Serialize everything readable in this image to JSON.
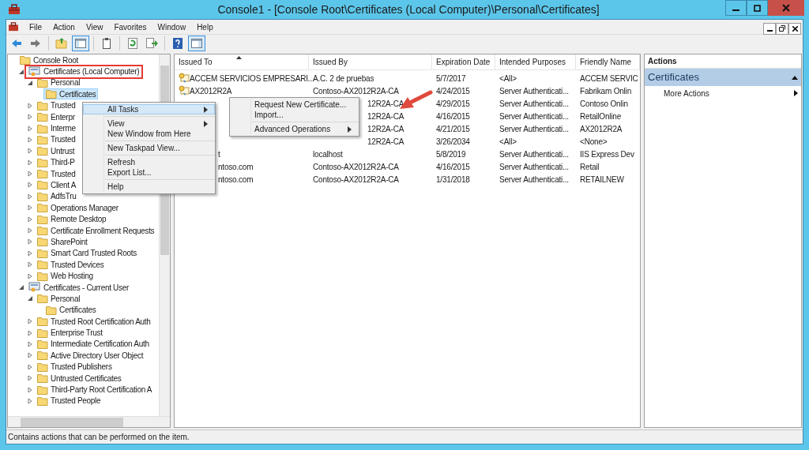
{
  "window": {
    "title": "Console1 - [Console Root\\Certificates (Local Computer)\\Personal\\Certificates]"
  },
  "menu_bar": [
    "File",
    "Action",
    "View",
    "Favorites",
    "Window",
    "Help"
  ],
  "toolbar": [
    {
      "kind": "back",
      "pressed": false
    },
    {
      "kind": "forward",
      "pressed": false
    },
    {
      "kind": "separator"
    },
    {
      "kind": "up",
      "pressed": false
    },
    {
      "kind": "tree",
      "pressed": true
    },
    {
      "kind": "separator"
    },
    {
      "kind": "clipboard",
      "pressed": false
    },
    {
      "kind": "separator"
    },
    {
      "kind": "refresh",
      "pressed": false
    },
    {
      "kind": "export",
      "pressed": false
    },
    {
      "kind": "separator"
    },
    {
      "kind": "help",
      "pressed": false
    },
    {
      "kind": "pane",
      "pressed": true
    }
  ],
  "tree": [
    {
      "label": "Console Root",
      "kind": "folder",
      "selected": false,
      "highlighted": false,
      "children": [
        {
          "label": "Certificates (Local Computer)",
          "kind": "snapin",
          "expanded": true,
          "selected": false,
          "highlighted": true,
          "children": [
            {
              "label": "Personal",
              "kind": "folder",
              "expanded": true,
              "selected": false,
              "highlighted": false,
              "children": [
                {
                  "label": "Certificates",
                  "kind": "folder",
                  "selected": true,
                  "highlighted": false
                }
              ]
            },
            {
              "label": "Trusted",
              "kind": "folder",
              "expanded": false,
              "selected": false,
              "highlighted": false
            },
            {
              "label": "Enterpr",
              "kind": "folder",
              "expanded": false,
              "selected": false,
              "highlighted": false
            },
            {
              "label": "Interme",
              "kind": "folder",
              "expanded": false,
              "selected": false,
              "highlighted": false
            },
            {
              "label": "Trusted",
              "kind": "folder",
              "expanded": false,
              "selected": false,
              "highlighted": false
            },
            {
              "label": "Untrust",
              "kind": "folder",
              "expanded": false,
              "selected": false,
              "highlighted": false
            },
            {
              "label": "Third-P",
              "kind": "folder",
              "expanded": false,
              "selected": false,
              "highlighted": false
            },
            {
              "label": "Trusted",
              "kind": "folder",
              "expanded": false,
              "selected": false,
              "highlighted": false
            },
            {
              "label": "Client A",
              "kind": "folder",
              "expanded": false,
              "selected": false,
              "highlighted": false
            },
            {
              "label": "AdfsTru",
              "kind": "folder",
              "expanded": false,
              "selected": false,
              "highlighted": false
            },
            {
              "label": "Operations Manager",
              "kind": "folder",
              "expanded": false,
              "selected": false,
              "highlighted": false
            },
            {
              "label": "Remote Desktop",
              "kind": "folder",
              "expanded": false,
              "selected": false,
              "highlighted": false
            },
            {
              "label": "Certificate Enrollment Requests",
              "kind": "folder",
              "expanded": false,
              "selected": false,
              "highlighted": false
            },
            {
              "label": "SharePoint",
              "kind": "folder",
              "expanded": false,
              "selected": false,
              "highlighted": false
            },
            {
              "label": "Smart Card Trusted Roots",
              "kind": "folder",
              "expanded": false,
              "selected": false,
              "highlighted": false
            },
            {
              "label": "Trusted Devices",
              "kind": "folder",
              "expanded": false,
              "selected": false,
              "highlighted": false
            },
            {
              "label": "Web Hosting",
              "kind": "folder",
              "expanded": false,
              "selected": false,
              "highlighted": false
            }
          ]
        },
        {
          "label": "Certificates - Current User",
          "kind": "snapin",
          "expanded": true,
          "selected": false,
          "highlighted": false,
          "children": [
            {
              "label": "Personal",
              "kind": "folder",
              "expanded": true,
              "selected": false,
              "highlighted": false,
              "children": [
                {
                  "label": "Certificates",
                  "kind": "folder",
                  "selected": false,
                  "highlighted": false
                }
              ]
            },
            {
              "label": "Trusted Root Certification Auth",
              "kind": "folder",
              "expanded": false,
              "selected": false,
              "highlighted": false
            },
            {
              "label": "Enterprise Trust",
              "kind": "folder",
              "expanded": false,
              "selected": false,
              "highlighted": false
            },
            {
              "label": "Intermediate Certification Auth",
              "kind": "folder",
              "expanded": false,
              "selected": false,
              "highlighted": false
            },
            {
              "label": "Active Directory User Object",
              "kind": "folder",
              "expanded": false,
              "selected": false,
              "highlighted": false
            },
            {
              "label": "Trusted Publishers",
              "kind": "folder",
              "expanded": false,
              "selected": false,
              "highlighted": false
            },
            {
              "label": "Untrusted Certificates",
              "kind": "folder",
              "expanded": false,
              "selected": false,
              "highlighted": false
            },
            {
              "label": "Third-Party Root Certification A",
              "kind": "folder",
              "expanded": false,
              "selected": false,
              "highlighted": false
            },
            {
              "label": "Trusted People",
              "kind": "folder",
              "expanded": false,
              "selected": false,
              "highlighted": false
            }
          ]
        }
      ]
    }
  ],
  "table": {
    "columns": [
      "Issued To",
      "Issued By",
      "Expiration Date",
      "Intended Purposes",
      "Friendly Name"
    ],
    "rows": [
      {
        "issued_to": "ACCEM SERVICIOS EMPRESARI...",
        "issued_to_covered": false,
        "issued_by": "A.C. 2 de pruebas",
        "issued_by_covered": false,
        "expiration_date": "5/7/2017",
        "intended_purposes": "<All>",
        "friendly_name": "ACCEM SERVIC"
      },
      {
        "issued_to": "AX2012R2A",
        "issued_to_covered": false,
        "issued_by": "Contoso-AX2012R2A-CA",
        "issued_by_covered": false,
        "expiration_date": "4/24/2015",
        "intended_purposes": "Server Authenticati...",
        "friendly_name": "Fabrikam Onlin"
      },
      {
        "issued_to_covered": true,
        "issued_by": "12R2A-CA",
        "issued_by_covered": true,
        "expiration_date": "4/29/2015",
        "intended_purposes": "Server Authenticati...",
        "friendly_name": "Contoso Onlin"
      },
      {
        "issued_to_covered": true,
        "issued_by": "12R2A-CA",
        "issued_by_covered": true,
        "expiration_date": "4/16/2015",
        "intended_purposes": "Server Authenticati...",
        "friendly_name": "RetailOnline"
      },
      {
        "issued_to_covered": true,
        "issued_by": "12R2A-CA",
        "issued_by_covered": true,
        "expiration_date": "4/21/2015",
        "intended_purposes": "Server Authenticati...",
        "friendly_name": "AX2012R2A"
      },
      {
        "issued_to_covered": true,
        "issued_by": "12R2A-CA",
        "issued_by_covered": true,
        "expiration_date": "3/26/2034",
        "intended_purposes": "<All>",
        "friendly_name": "<None>"
      },
      {
        "issued_to": "t",
        "issued_to_covered": true,
        "issued_by": "localhost",
        "issued_by_covered": false,
        "expiration_date": "5/8/2019",
        "intended_purposes": "Server Authenticati...",
        "friendly_name": "IIS Express Dev"
      },
      {
        "issued_to": "ntoso.com",
        "issued_to_covered": true,
        "issued_by": "Contoso-AX2012R2A-CA",
        "issued_by_covered": false,
        "expiration_date": "4/16/2015",
        "intended_purposes": "Server Authenticati...",
        "friendly_name": "Retail"
      },
      {
        "issued_to": "ntoso.com",
        "issued_to_covered": true,
        "issued_by": "Contoso-AX2012R2A-CA",
        "issued_by_covered": false,
        "expiration_date": "1/31/2018",
        "intended_purposes": "Server Authenticati...",
        "friendly_name": "RETAILNEW"
      }
    ]
  },
  "actions": {
    "title": "Actions",
    "section": {
      "title": "Certificates",
      "expanded": true
    },
    "items": [
      {
        "label": "More Actions",
        "submenu": true
      }
    ]
  },
  "context_menu": {
    "groups": [
      [
        {
          "label": "All Tasks",
          "submenu": true,
          "selected": true
        }
      ],
      [
        {
          "label": "View",
          "submenu": true,
          "selected": false
        },
        {
          "label": "New Window from Here",
          "submenu": false,
          "selected": false
        }
      ],
      [
        {
          "label": "New Taskpad View...",
          "submenu": false,
          "selected": false
        }
      ],
      [
        {
          "label": "Refresh",
          "submenu": false,
          "selected": false
        },
        {
          "label": "Export List...",
          "submenu": false,
          "selected": false
        }
      ],
      [
        {
          "label": "Help",
          "submenu": false,
          "selected": false
        }
      ]
    ]
  },
  "submenu": {
    "groups": [
      [
        {
          "label": "Request New Certificate...",
          "submenu": false,
          "selected": false
        },
        {
          "label": "Import...",
          "submenu": false,
          "selected": false
        }
      ],
      [
        {
          "label": "Advanced Operations",
          "submenu": true,
          "selected": false
        }
      ]
    ]
  },
  "status_bar": "Contains actions that can be performed on the item."
}
